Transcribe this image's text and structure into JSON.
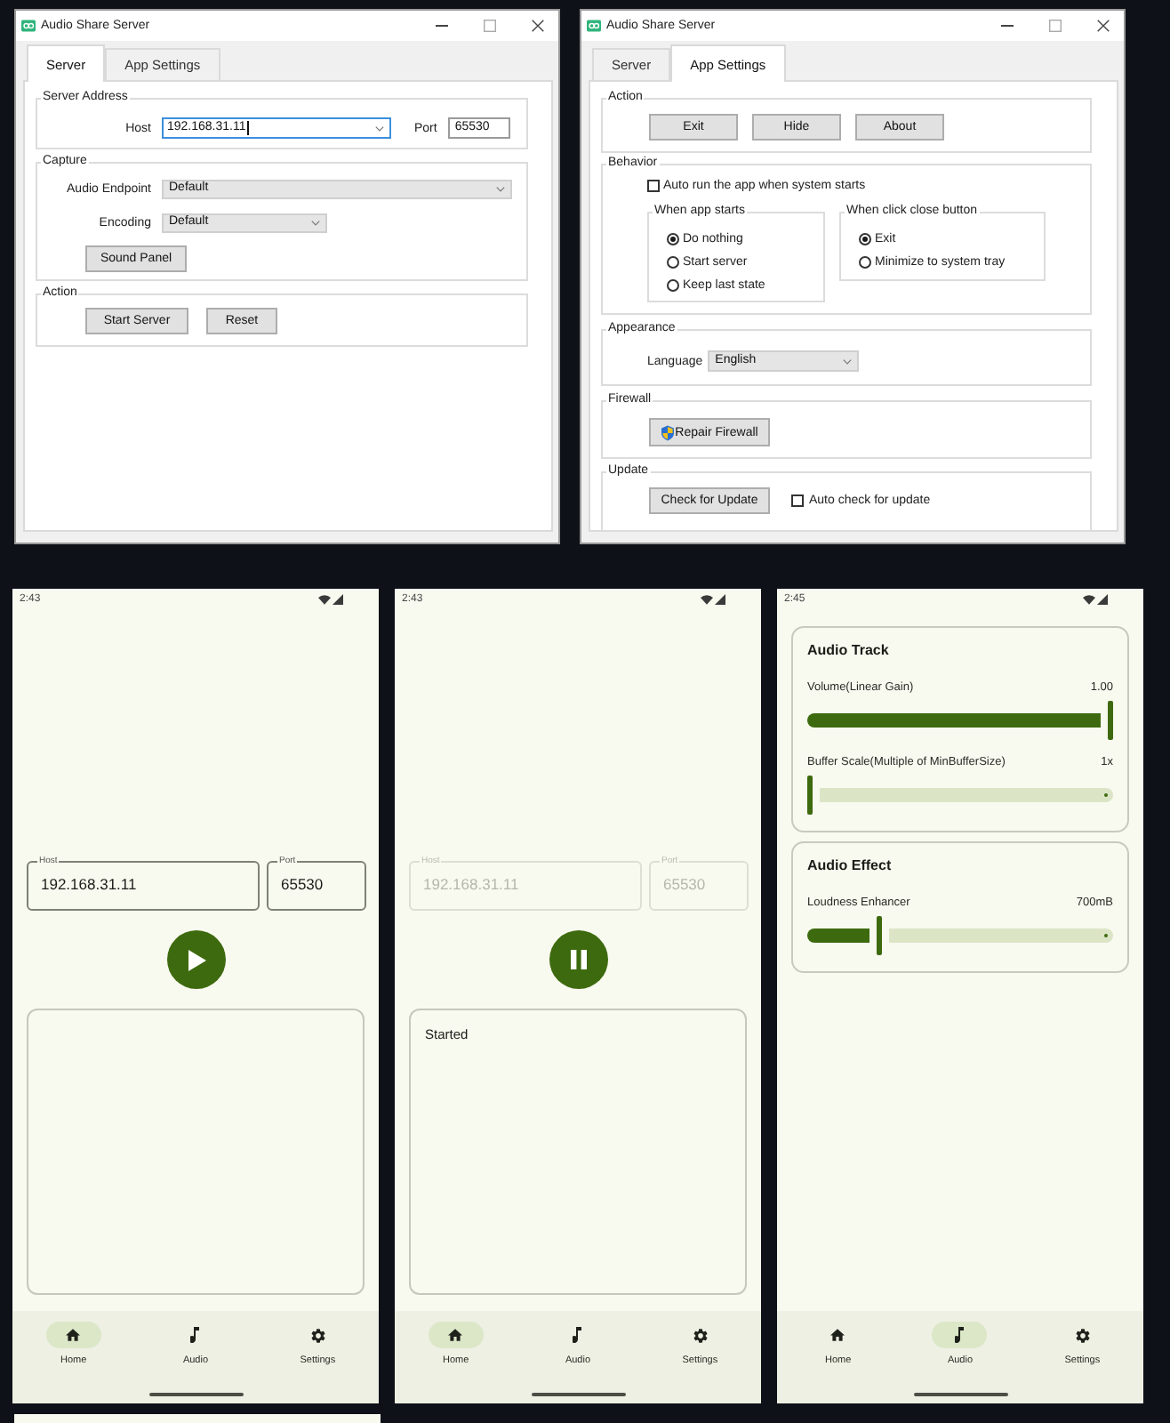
{
  "windows": [
    {
      "title": "Audio Share Server",
      "tabs": [
        {
          "label": "Server",
          "selected": true
        },
        {
          "label": "App Settings",
          "selected": false
        }
      ],
      "panel": {
        "kind": "server",
        "server_address": {
          "title": "Server Address",
          "host": {
            "label": "Host",
            "value": "192.168.31.11",
            "focused": true
          },
          "port": {
            "label": "Port",
            "value": "65530"
          }
        },
        "capture": {
          "title": "Capture",
          "endpoint": {
            "label": "Audio Endpoint",
            "value": "Default"
          },
          "encoding": {
            "label": "Encoding",
            "value": "Default"
          },
          "button": "Sound Panel"
        },
        "action": {
          "title": "Action",
          "buttons": [
            "Start Server",
            "Reset"
          ]
        }
      }
    },
    {
      "title": "Audio Share Server",
      "tabs": [
        {
          "label": "Server",
          "selected": false
        },
        {
          "label": "App Settings",
          "selected": true
        }
      ],
      "panel": {
        "kind": "app_settings",
        "action": {
          "title": "Action",
          "buttons": [
            "Exit",
            "Hide",
            "About"
          ]
        },
        "behavior": {
          "title": "Behavior",
          "auto_run": {
            "label": "Auto run the app when system starts",
            "checked": false
          },
          "option_groups": [
            {
              "title": "When app starts",
              "options": [
                {
                  "label": "Do nothing",
                  "selected": true
                },
                {
                  "label": "Start server",
                  "selected": false
                },
                {
                  "label": "Keep last state",
                  "selected": false
                }
              ]
            },
            {
              "title": "When click close button",
              "options": [
                {
                  "label": "Exit",
                  "selected": true
                },
                {
                  "label": "Minimize to system tray",
                  "selected": false
                }
              ]
            }
          ]
        },
        "appearance": {
          "title": "Appearance",
          "language": {
            "label": "Language",
            "value": "English"
          }
        },
        "firewall": {
          "title": "Firewall",
          "button": "Repair Firewall"
        },
        "update": {
          "title": "Update",
          "button": "Check for Update",
          "auto_check": {
            "label": "Auto check for update",
            "checked": false
          }
        }
      }
    }
  ],
  "phones": [
    {
      "status_time": "2:43",
      "screen": {
        "kind": "home",
        "host": {
          "label": "Host",
          "value": "192.168.31.11"
        },
        "port": {
          "label": "Port",
          "value": "65530"
        },
        "fields_disabled": false,
        "running": false
      },
      "nav": [
        {
          "label": "Home",
          "selected": true
        },
        {
          "label": "Audio",
          "selected": false
        },
        {
          "label": "Settings",
          "selected": false
        }
      ]
    },
    {
      "status_time": "2:43",
      "screen": {
        "kind": "home",
        "host": {
          "label": "Host",
          "value": "192.168.31.11"
        },
        "port": {
          "label": "Port",
          "value": "65530"
        },
        "fields_disabled": true,
        "running": true,
        "log": "Started"
      },
      "nav": [
        {
          "label": "Home",
          "selected": true
        },
        {
          "label": "Audio",
          "selected": false
        },
        {
          "label": "Settings",
          "selected": false
        }
      ]
    },
    {
      "status_time": "2:45",
      "screen": {
        "kind": "audio",
        "cards": [
          {
            "title": "Audio Track",
            "sliders": [
              {
                "label": "Volume(Linear Gain)",
                "reading": "1.00",
                "level": 1
              },
              {
                "label": "Buffer Scale(Multiple of MinBufferSize)",
                "reading": "1x",
                "level": 0
              }
            ]
          },
          {
            "title": "Audio Effect",
            "sliders": [
              {
                "label": "Loudness Enhancer",
                "reading": "700mB",
                "level": 0.23
              }
            ]
          }
        ]
      },
      "nav": [
        {
          "label": "Home",
          "selected": false
        },
        {
          "label": "Audio",
          "selected": true
        },
        {
          "label": "Settings",
          "selected": false
        }
      ]
    }
  ]
}
